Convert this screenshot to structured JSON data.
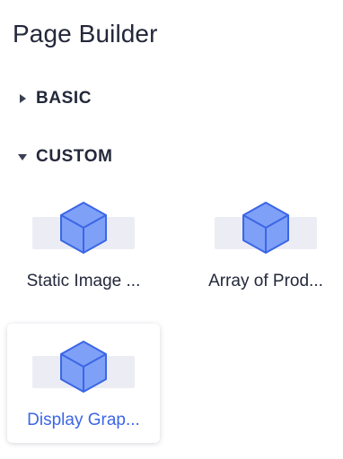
{
  "header": {
    "title": "Page Builder"
  },
  "sections": [
    {
      "label": "BASIC",
      "expanded": false
    },
    {
      "label": "CUSTOM",
      "expanded": true
    }
  ],
  "colors": {
    "accent": "#3b66e6",
    "cube_fill": "#7ea0f7",
    "cube_stroke": "#3b66e6",
    "text": "#23283a",
    "thumb_bg": "#ecedf4"
  },
  "components": [
    {
      "label": "Static Image ...",
      "icon": "cube-icon",
      "selected": false
    },
    {
      "label": "Array of Prod...",
      "icon": "cube-icon",
      "selected": false
    },
    {
      "label": "Display Grap...",
      "icon": "cube-icon",
      "selected": true
    }
  ]
}
